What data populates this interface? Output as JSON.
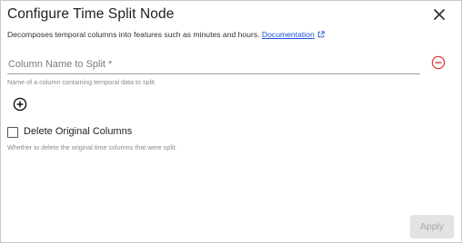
{
  "dialog": {
    "title": "Configure Time Split Node",
    "description": "Decomposes temporal columns into features such as minutes and hours.",
    "doc_link_label": "Documentation"
  },
  "column_field": {
    "label": "Column Name to Split *",
    "value": "",
    "helper": "Name of a column containing temporal data to split."
  },
  "delete_option": {
    "label": "Delete Original Columns",
    "checked": false,
    "helper": "Whether to delete the original time columns that were split."
  },
  "footer": {
    "apply_label": "Apply"
  },
  "colors": {
    "link": "#1a4fd6",
    "remove_icon": "#e53935",
    "apply_disabled_bg": "#e3e3e3"
  },
  "icons": [
    "close-icon",
    "external-link-icon",
    "remove-circle-icon",
    "add-circle-icon",
    "checkbox-icon"
  ]
}
